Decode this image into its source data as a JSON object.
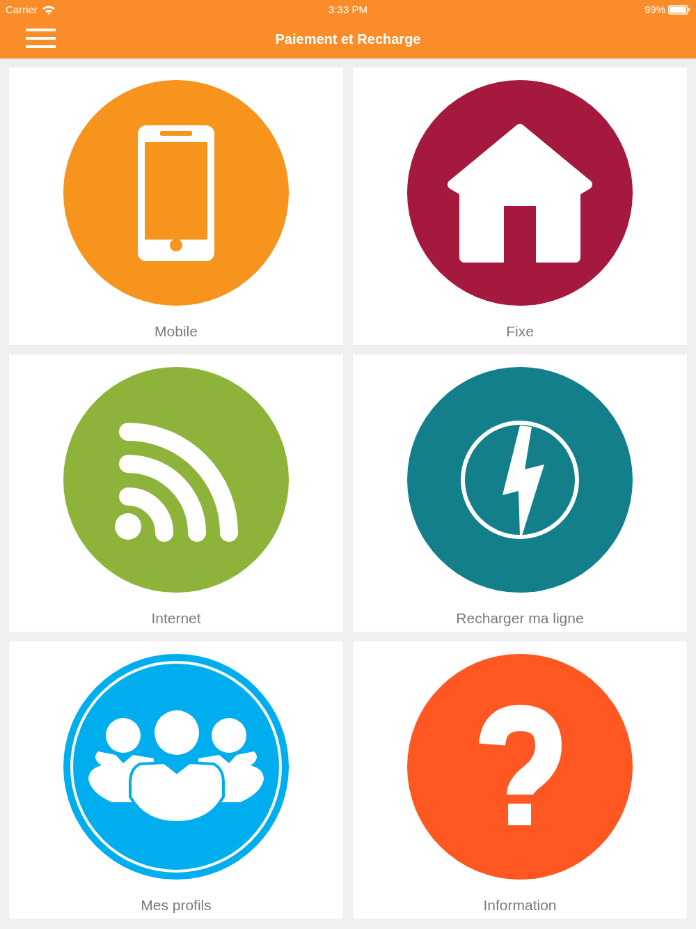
{
  "status_bar": {
    "carrier": "Carrier",
    "time": "3:33 PM",
    "battery": "99%"
  },
  "header": {
    "title": "Paiement et Recharge"
  },
  "tiles": [
    {
      "label": "Mobile",
      "kind": "phone",
      "color": "#f7941d"
    },
    {
      "label": "Fixe",
      "kind": "house",
      "color": "#a4193d"
    },
    {
      "label": "Internet",
      "kind": "rss",
      "color": "#8db33a"
    },
    {
      "label": "Recharger ma ligne",
      "kind": "power",
      "color": "#137f8b"
    },
    {
      "label": "Mes profils",
      "kind": "people",
      "color": "#00aeef"
    },
    {
      "label": "Information",
      "kind": "question",
      "color": "#ff5722"
    }
  ]
}
